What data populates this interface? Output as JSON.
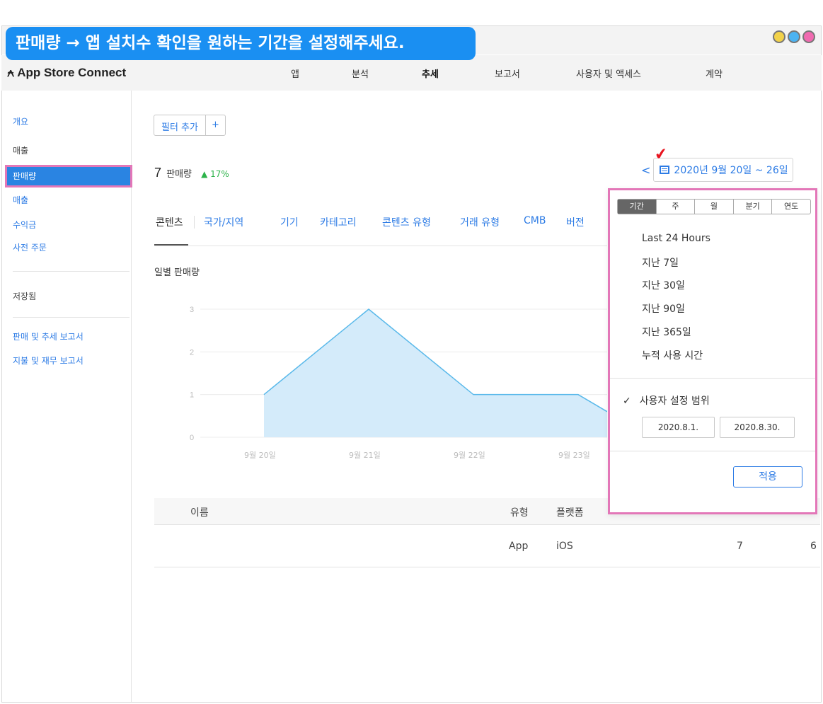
{
  "caption": "판매량 → 앱 설치수 확인을 원하는 기간을 설정해주세요.",
  "window_dots_colors": [
    "#f2d24a",
    "#4bb3f2",
    "#f06ab0"
  ],
  "header": {
    "brand": "App Store Connect",
    "brand_icon": "app-store-icon",
    "nav": [
      "앱",
      "분석",
      "추세",
      "보고서",
      "사용자 및 액세스",
      "계약"
    ],
    "active_nav": "추세"
  },
  "sidebar": {
    "items": [
      "개요",
      "매출",
      "판매량",
      "매출",
      "수익금",
      "사전 주문"
    ],
    "selected": "판매량",
    "saved_label": "저장됨",
    "reports": [
      "판매 및 추세 보고서",
      "지불 및 재무 보고서"
    ]
  },
  "filter": {
    "label": "필터 추가",
    "plus": "+"
  },
  "summary": {
    "value": "7",
    "label": "판매량",
    "change": "▲ 17%"
  },
  "date_range": {
    "arrow": "<",
    "label": "2020년 9월 20일 ~ 26일"
  },
  "tabs": [
    "콘텐츠",
    "국가/지역",
    "기기",
    "카테고리",
    "콘텐츠 유형",
    "거래 유형",
    "CMB",
    "버전"
  ],
  "chart_title": "일별 판매량",
  "chart_data": {
    "type": "area",
    "title": "일별 판매량",
    "categories": [
      "9월 20일",
      "9월 21일",
      "9월 22일",
      "9월 23일"
    ],
    "values": [
      1,
      3,
      1,
      1
    ],
    "ylim": [
      0,
      3
    ],
    "yticks": [
      "0",
      "1",
      "2",
      "3"
    ],
    "grid": true,
    "colors": {
      "fill": "#d4ebfa",
      "line": "#5ab9ea"
    }
  },
  "table": {
    "headers": {
      "name": "이름",
      "type": "유형",
      "platform": "플랫폼"
    },
    "rows": [
      {
        "type": "App",
        "platform": "iOS",
        "units": "7",
        "extra": "6"
      }
    ]
  },
  "popup": {
    "segments": [
      "기간",
      "주",
      "월",
      "분기",
      "연도"
    ],
    "active_segment": "기간",
    "presets": [
      "Last 24 Hours",
      "지난 7일",
      "지난 30일",
      "지난 90일",
      "지난 365일",
      "누적 사용 시간"
    ],
    "custom_label": "사용자 설정 범위",
    "custom_check": "✓",
    "start_date": "2020.8.1.",
    "end_date": "2020.8.30.",
    "apply": "적용"
  }
}
